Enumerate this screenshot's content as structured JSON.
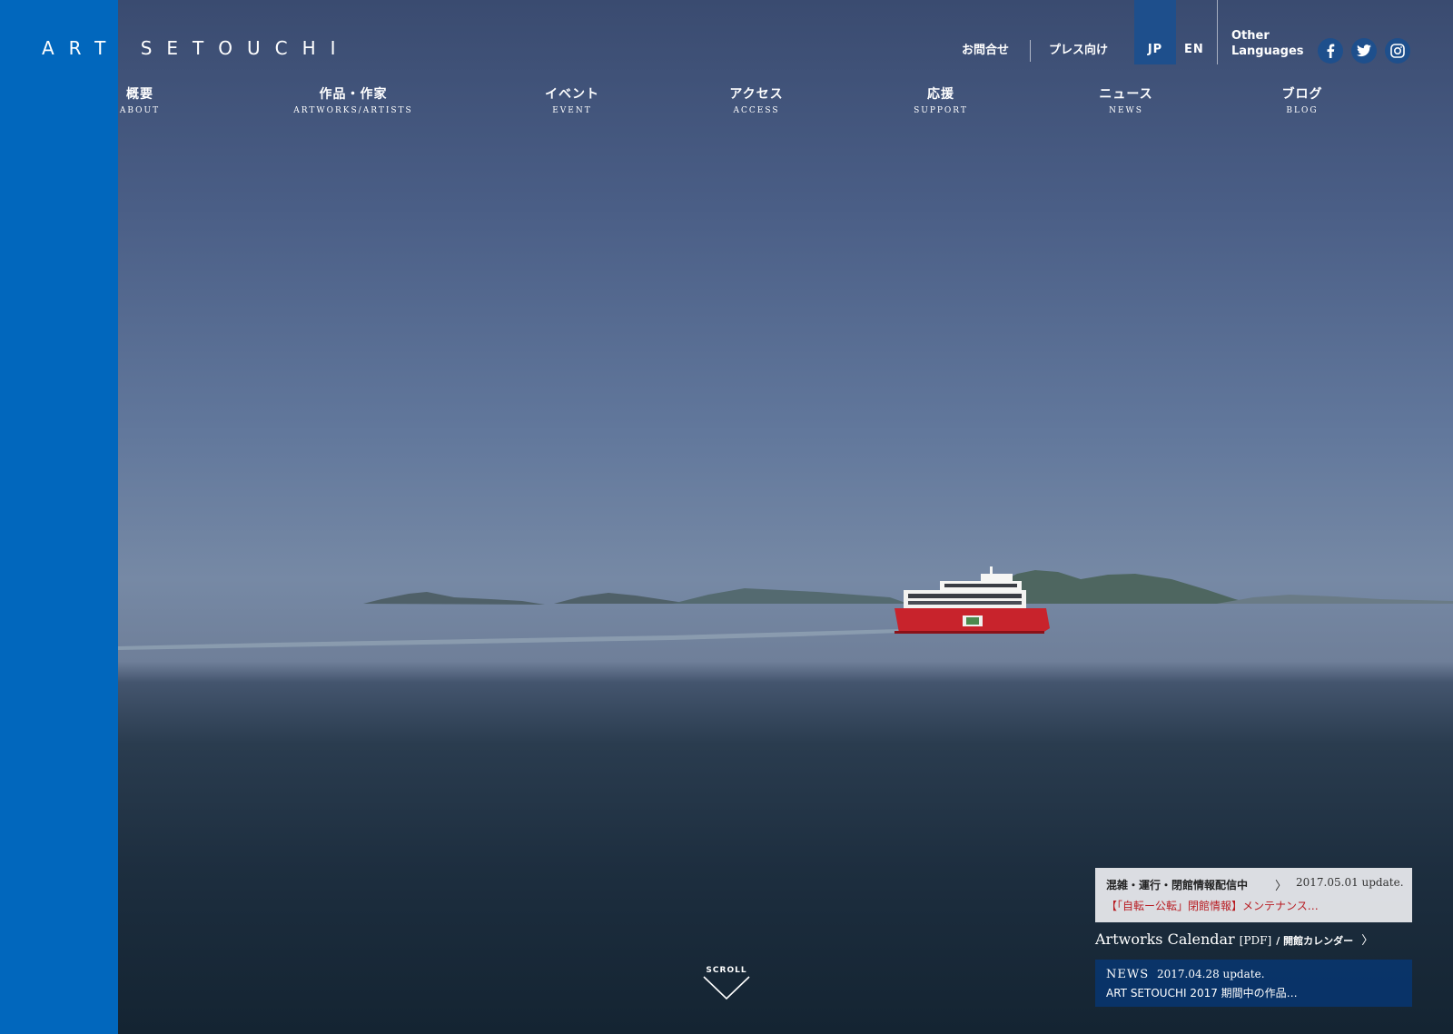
{
  "site": {
    "logo": "ART SETOUCHI"
  },
  "utility": {
    "contact": "お問合せ",
    "press": "プレス向け",
    "lang_jp": "JP",
    "lang_en": "EN",
    "other_languages_line1": "Other",
    "other_languages_line2": "Languages",
    "social": [
      "facebook-icon",
      "twitter-icon",
      "instagram-icon"
    ],
    "active_color": "#1e4f8c"
  },
  "nav": {
    "items": [
      {
        "jp": "概要",
        "en": "ABOUT"
      },
      {
        "jp": "作品・作家",
        "en": "ARTWORKS/ARTISTS"
      },
      {
        "jp": "イベント",
        "en": "EVENT"
      },
      {
        "jp": "アクセス",
        "en": "ACCESS"
      },
      {
        "jp": "応援",
        "en": "SUPPORT"
      },
      {
        "jp": "ニュース",
        "en": "NEWS"
      },
      {
        "jp": "ブログ",
        "en": "BLOG"
      }
    ]
  },
  "notice": {
    "title": "混雑・運行・閉館情報配信中",
    "date": "2017.05.01 update.",
    "headline": "【「自転ー公転」閉館情報】メンテナンス…"
  },
  "calendar": {
    "title": "Artworks Calendar",
    "pdf": "[PDF]",
    "subtitle": " / 開館カレンダー"
  },
  "news": {
    "label": "NEWS",
    "date": "2017.04.28 update.",
    "text": "ART SETOUCHI 2017 期間中の作品…"
  },
  "scroll": {
    "label": "SCROLL"
  },
  "colors": {
    "side_band": "#0167bd",
    "ferry": "#c8232c",
    "news_bg": "#083670",
    "notice_text": "#b81c22"
  }
}
